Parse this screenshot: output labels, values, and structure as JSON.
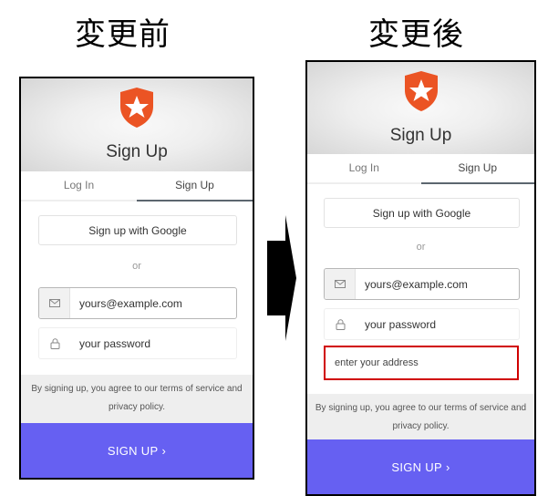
{
  "captions": {
    "before": "変更前",
    "after": "変更後"
  },
  "form": {
    "title": "Sign Up",
    "tabs": {
      "login": "Log In",
      "signup": "Sign Up"
    },
    "google_button": "Sign up with Google",
    "or": "or",
    "email_placeholder": "yours@example.com",
    "password_placeholder": "your password",
    "address_placeholder": "enter your address",
    "terms_line1": "By signing up, you agree to our terms of service and",
    "terms_line2": "privacy policy.",
    "submit": "SIGN UP",
    "submit_chevron": "›"
  },
  "icons": {
    "logo": "shield-star-icon",
    "email": "envelope-icon",
    "password": "lock-icon",
    "arrow": "right-arrow-icon"
  },
  "colors": {
    "brand": "#eb5424",
    "submit_bg": "#6660f2",
    "highlight": "#d00000"
  }
}
